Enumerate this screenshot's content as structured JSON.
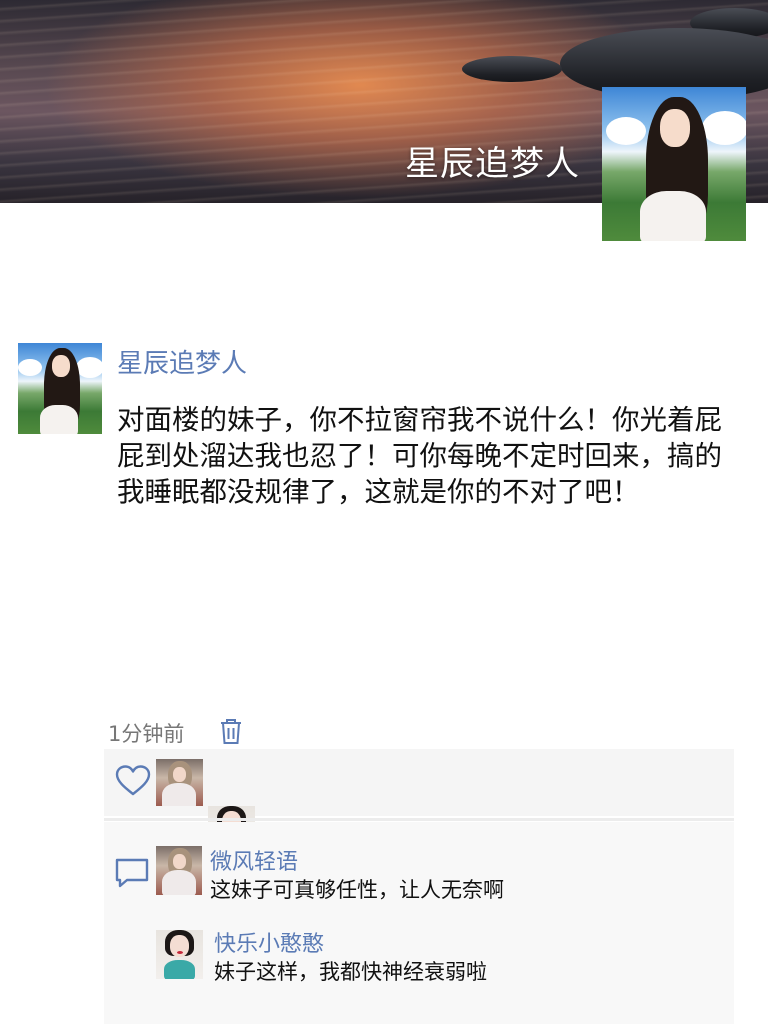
{
  "cover": {
    "username": "星辰追梦人",
    "background": "lake-sunset-reflection-image",
    "avatar": "avatar-girl-meadow-image"
  },
  "post": {
    "author": "星辰追梦人",
    "text": "对面楼的妹子，你不拉窗帘我不说什么！你光着屁屁到处溜达我也忍了！可你每晚不定时回来，搞的我睡眠都没规律了，这就是你的不对了吧！",
    "time": "1分钟前",
    "delete_icon": "trash-icon"
  },
  "likes": {
    "icon": "heart-icon",
    "users": [
      "liker-avatar-1",
      "liker-avatar-2"
    ]
  },
  "comments": {
    "icon": "comment-icon",
    "items": [
      {
        "name": "微风轻语",
        "text": "这妹子可真够任性，让人无奈啊"
      },
      {
        "name": "快乐小憨憨",
        "text": "妹子这样，我都快神经衰弱啦"
      }
    ]
  },
  "colors": {
    "link": "#5b7bb5",
    "text": "#111111",
    "meta": "#777777",
    "panel": "#f5f5f5"
  }
}
